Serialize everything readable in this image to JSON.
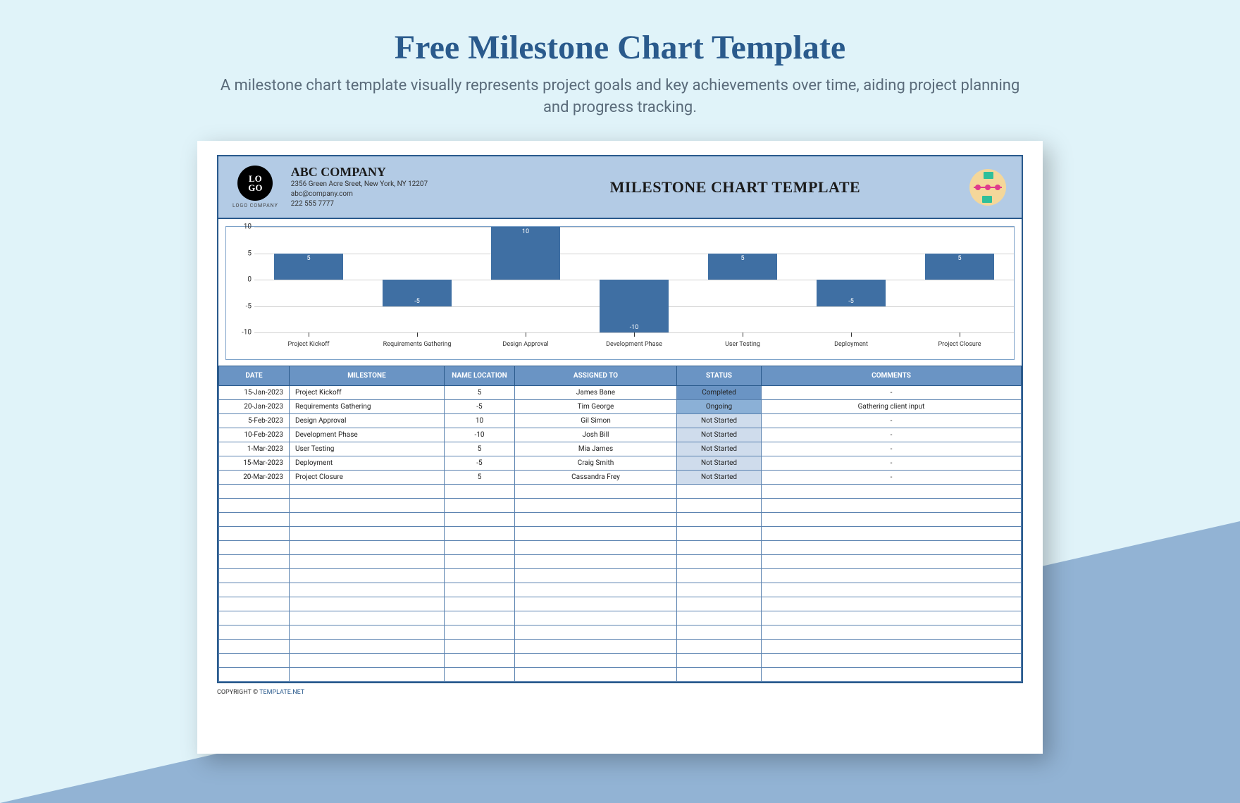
{
  "page": {
    "title": "Free Milestone Chart Template",
    "subtitle": "A milestone chart template visually represents project goals and key achievements over time, aiding project planning and progress tracking."
  },
  "header": {
    "logo_text": "LO\nGO",
    "logo_sub": "LOGO COMPANY",
    "company_name": "ABC COMPANY",
    "address": "2356 Green Acre Sreet, New York, NY 12207",
    "email": "abc@company.com",
    "phone": "222 555 7777",
    "doc_title": "MILESTONE CHART TEMPLATE"
  },
  "chart_data": {
    "type": "bar",
    "categories": [
      "Project Kickoff",
      "Requirements Gathering",
      "Design Approval",
      "Development Phase",
      "User Testing",
      "Deployment",
      "Project Closure"
    ],
    "values": [
      5,
      -5,
      10,
      -10,
      5,
      -5,
      5
    ],
    "ylim": [
      -10,
      10
    ],
    "yticks": [
      -10,
      -5,
      0,
      5,
      10
    ]
  },
  "table": {
    "headers": {
      "date": "DATE",
      "milestone": "MILESTONE",
      "location": "NAME LOCATION",
      "assigned": "ASSIGNED TO",
      "status": "STATUS",
      "comments": "COMMENTS"
    },
    "rows": [
      {
        "date": "15-Jan-2023",
        "milestone": "Project Kickoff",
        "location": "5",
        "assigned": "James Bane",
        "status": "Completed",
        "status_class": "completed",
        "comments": "-"
      },
      {
        "date": "20-Jan-2023",
        "milestone": "Requirements Gathering",
        "location": "-5",
        "assigned": "Tim George",
        "status": "Ongoing",
        "status_class": "ongoing",
        "comments": "Gathering client input"
      },
      {
        "date": "5-Feb-2023",
        "milestone": "Design Approval",
        "location": "10",
        "assigned": "Gil Simon",
        "status": "Not Started",
        "status_class": "notstarted",
        "comments": "-"
      },
      {
        "date": "10-Feb-2023",
        "milestone": "Development Phase",
        "location": "-10",
        "assigned": "Josh Bill",
        "status": "Not Started",
        "status_class": "notstarted",
        "comments": "-"
      },
      {
        "date": "1-Mar-2023",
        "milestone": "User Testing",
        "location": "5",
        "assigned": "Mia James",
        "status": "Not Started",
        "status_class": "notstarted",
        "comments": "-"
      },
      {
        "date": "15-Mar-2023",
        "milestone": "Deployment",
        "location": "-5",
        "assigned": "Craig Smith",
        "status": "Not Started",
        "status_class": "notstarted",
        "comments": "-"
      },
      {
        "date": "20-Mar-2023",
        "milestone": "Project Closure",
        "location": "5",
        "assigned": "Cassandra Frey",
        "status": "Not Started",
        "status_class": "notstarted",
        "comments": "-"
      }
    ],
    "empty_rows": 14
  },
  "footer": {
    "copyright_label": "COPYRIGHT © ",
    "link_text": "TEMPLATE.NET"
  }
}
